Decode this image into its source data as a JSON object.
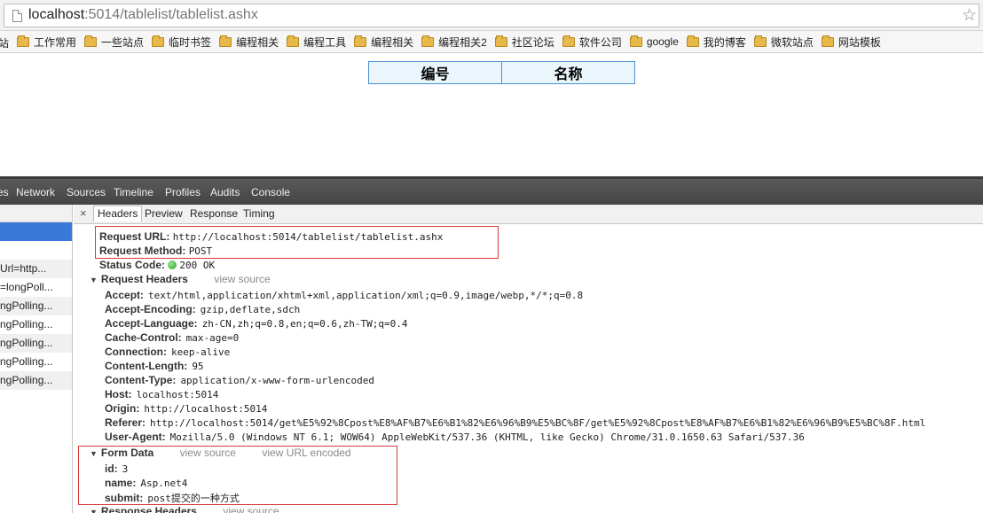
{
  "address_bar": {
    "url_host": "localhost",
    "url_rest": ":5014/tablelist/tablelist.ashx"
  },
  "bookmarks": [
    "站",
    "工作常用",
    "一些站点",
    "临时书签",
    "编程相关",
    "编程工具",
    "编程相关",
    "编程相关2",
    "社区论坛",
    "软件公司",
    "google",
    "我的博客",
    "微软站点",
    "网站模板"
  ],
  "page": {
    "table_headers": [
      "编号",
      "名称"
    ]
  },
  "devtools": {
    "tabs": [
      "es",
      "Network",
      "Sources",
      "Timeline",
      "Profiles",
      "Audits",
      "Console"
    ],
    "requests": [
      "",
      "",
      "Url=http...",
      "=longPoll...",
      "ngPolling...",
      "ngPolling...",
      "ngPolling...",
      "ngPolling...",
      "ngPolling..."
    ],
    "subtabs": [
      "Headers",
      "Preview",
      "Response",
      "Timing"
    ],
    "close_glyph": "×",
    "general": {
      "request_url_label": "Request URL:",
      "request_url": "http://localhost:5014/tablelist/tablelist.ashx",
      "request_method_label": "Request Method:",
      "request_method": "POST",
      "status_code_label": "Status Code:",
      "status_code": "200 OK"
    },
    "request_headers": {
      "title": "Request Headers",
      "view_source": "view source",
      "items": [
        {
          "k": "Accept:",
          "v": "text/html,application/xhtml+xml,application/xml;q=0.9,image/webp,*/*;q=0.8"
        },
        {
          "k": "Accept-Encoding:",
          "v": "gzip,deflate,sdch"
        },
        {
          "k": "Accept-Language:",
          "v": "zh-CN,zh;q=0.8,en;q=0.6,zh-TW;q=0.4"
        },
        {
          "k": "Cache-Control:",
          "v": "max-age=0"
        },
        {
          "k": "Connection:",
          "v": "keep-alive"
        },
        {
          "k": "Content-Length:",
          "v": "95"
        },
        {
          "k": "Content-Type:",
          "v": "application/x-www-form-urlencoded"
        },
        {
          "k": "Host:",
          "v": "localhost:5014"
        },
        {
          "k": "Origin:",
          "v": "http://localhost:5014"
        },
        {
          "k": "Referer:",
          "v": "http://localhost:5014/get%E5%92%8Cpost%E8%AF%B7%E6%B1%82%E6%96%B9%E5%BC%8F/get%E5%92%8Cpost%E8%AF%B7%E6%B1%82%E6%96%B9%E5%BC%8F.html"
        },
        {
          "k": "User-Agent:",
          "v": "Mozilla/5.0 (Windows NT 6.1; WOW64) AppleWebKit/537.36 (KHTML, like Gecko) Chrome/31.0.1650.63 Safari/537.36"
        }
      ]
    },
    "form_data": {
      "title": "Form Data",
      "view_source": "view source",
      "view_url_encoded": "view URL encoded",
      "items": [
        {
          "k": "id:",
          "v": "3"
        },
        {
          "k": "name:",
          "v": "Asp.net4"
        },
        {
          "k": "submit:",
          "v": "post提交的一种方式"
        }
      ]
    },
    "response_headers": {
      "title": "Response Headers",
      "view_source": "view source"
    }
  },
  "colors": {
    "highlight_box": "#d63a3a",
    "selected_row": "#3879d9",
    "table_border": "#4b8fd1"
  }
}
